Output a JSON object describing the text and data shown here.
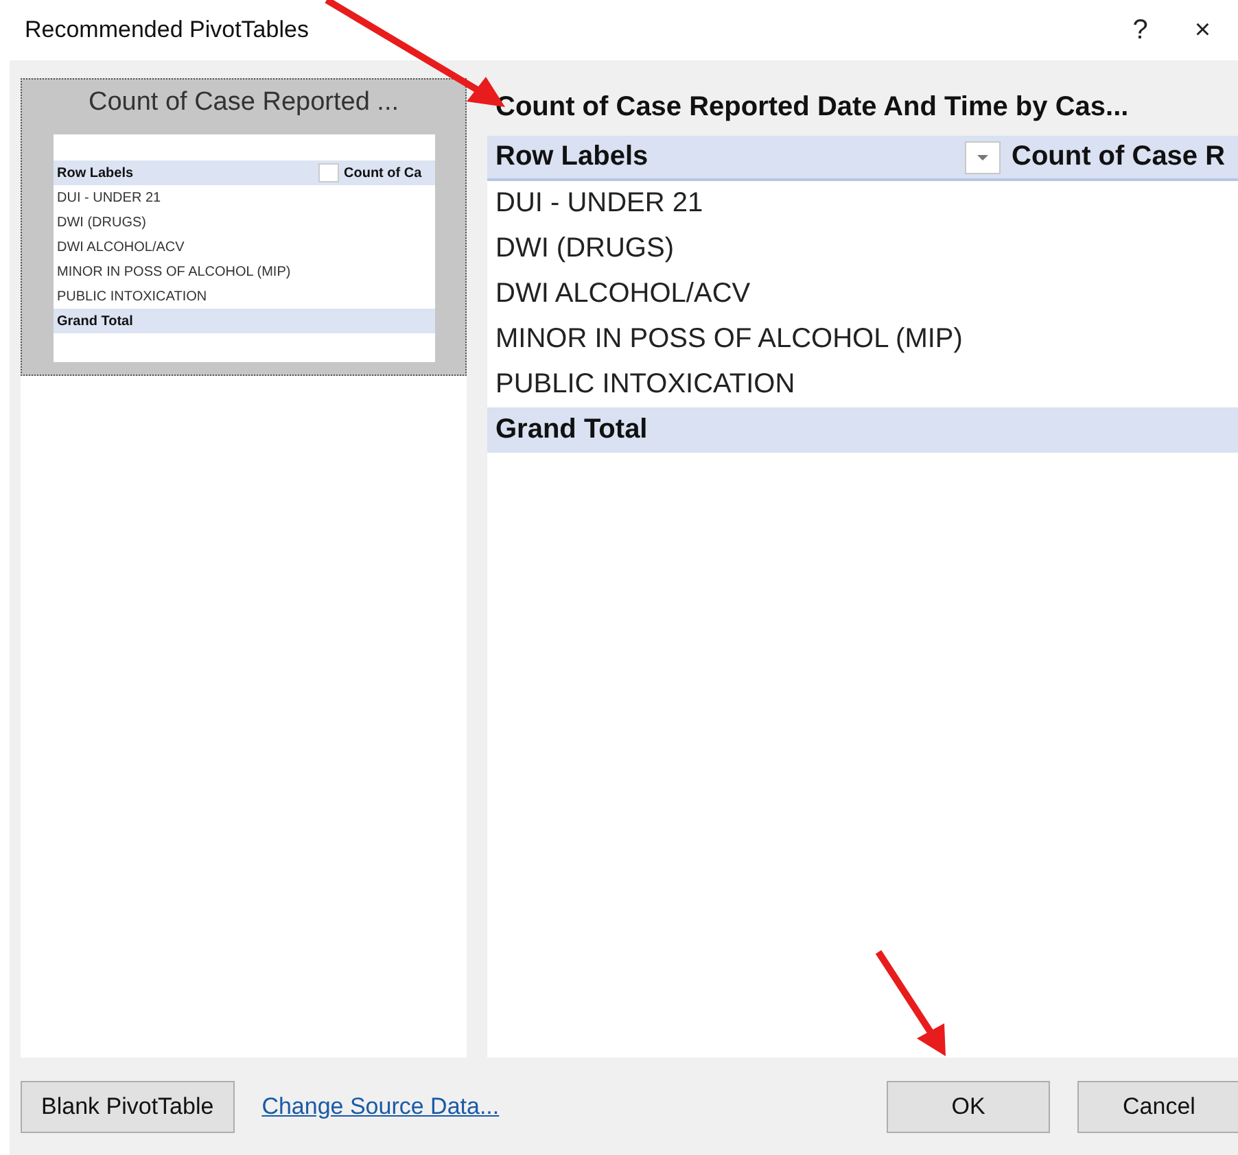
{
  "window": {
    "title": "Recommended PivotTables",
    "help": "?",
    "close": "×"
  },
  "recommendations": [
    {
      "title": "Count of Case Reported ...",
      "selected": true,
      "columns": [
        "Row Labels",
        "Count of Ca"
      ],
      "rows": [
        "DUI - UNDER 21",
        "DWI (DRUGS)",
        "DWI ALCOHOL/ACV",
        "MINOR IN POSS OF ALCOHOL (MIP)",
        "PUBLIC INTOXICATION"
      ],
      "total": "Grand Total"
    }
  ],
  "preview": {
    "title": "Count of Case Reported Date And Time by Cas...",
    "columns": [
      "Row Labels",
      "Count of Case R"
    ],
    "rows": [
      "DUI - UNDER 21",
      "DWI (DRUGS)",
      "DWI ALCOHOL/ACV",
      "MINOR IN POSS OF ALCOHOL (MIP)",
      "PUBLIC INTOXICATION"
    ],
    "total": "Grand Total"
  },
  "blank_button": "Blank PivotTable",
  "source_link": "Change Source Data...",
  "buttons": [
    "OK",
    "Cancel"
  ]
}
